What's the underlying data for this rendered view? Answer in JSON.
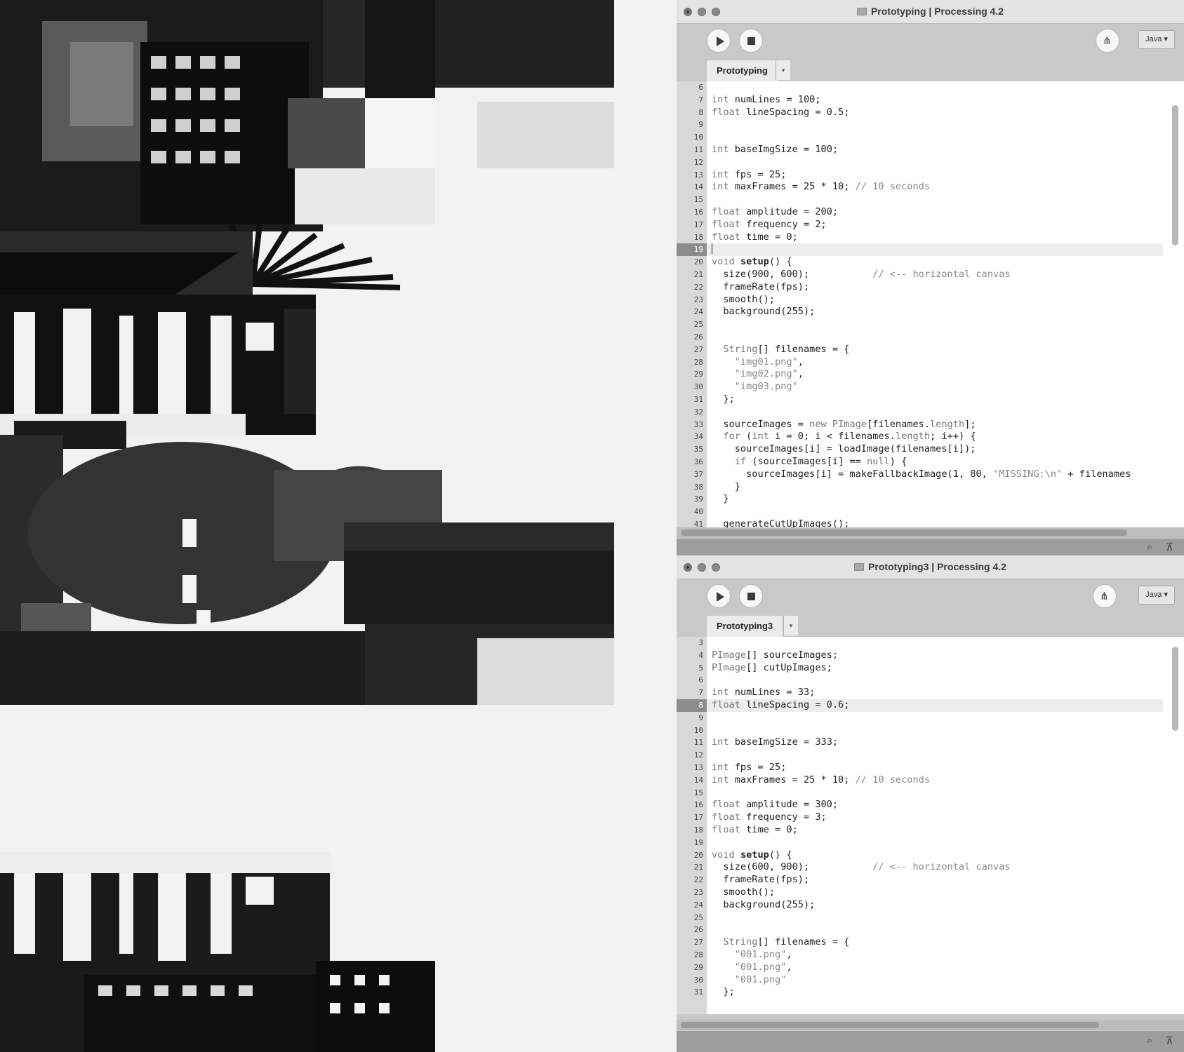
{
  "window1": {
    "title": "Prototyping | Processing 4.2",
    "tab": "Prototyping",
    "mode": "Java ▾",
    "tab_menu": "▾",
    "active_line": "19",
    "lines": [
      {
        "n": "6",
        "code": ""
      },
      {
        "n": "7",
        "code": "<span class='k'>int</span> numLines = 100;"
      },
      {
        "n": "8",
        "code": "<span class='k'>float</span> lineSpacing = 0.5;"
      },
      {
        "n": "9",
        "code": ""
      },
      {
        "n": "10",
        "code": ""
      },
      {
        "n": "11",
        "code": "<span class='k'>int</span> baseImgSize = 100;"
      },
      {
        "n": "12",
        "code": ""
      },
      {
        "n": "13",
        "code": "<span class='k'>int</span> fps = 25;"
      },
      {
        "n": "14",
        "code": "<span class='k'>int</span> maxFrames = 25 * 10; <span class='c'>// 10 seconds</span>"
      },
      {
        "n": "15",
        "code": ""
      },
      {
        "n": "16",
        "code": "<span class='k'>float</span> amplitude = 200;"
      },
      {
        "n": "17",
        "code": "<span class='k'>float</span> frequency = 2;"
      },
      {
        "n": "18",
        "code": "<span class='k'>float</span> time = 0;"
      },
      {
        "n": "19",
        "code": "<span class='caret'></span>"
      },
      {
        "n": "20",
        "code": "<span class='k'>void</span> <span class='b'>setup</span>() {"
      },
      {
        "n": "21",
        "code": "  size(900, 600);           <span class='c'>// &lt;-- horizontal canvas</span>"
      },
      {
        "n": "22",
        "code": "  frameRate(fps);"
      },
      {
        "n": "23",
        "code": "  smooth();"
      },
      {
        "n": "24",
        "code": "  background(255);"
      },
      {
        "n": "25",
        "code": ""
      },
      {
        "n": "26",
        "code": ""
      },
      {
        "n": "27",
        "code": "  <span class='k'>String</span>[] filenames = {"
      },
      {
        "n": "28",
        "code": "    <span class='s'>\"img01.png\"</span>,"
      },
      {
        "n": "29",
        "code": "    <span class='s'>\"img02.png\"</span>,"
      },
      {
        "n": "30",
        "code": "    <span class='s'>\"img03.png\"</span>"
      },
      {
        "n": "31",
        "code": "  };"
      },
      {
        "n": "32",
        "code": ""
      },
      {
        "n": "33",
        "code": "  sourceImages = <span class='k'>new</span> <span class='k'>PImage</span>[filenames.<span class='k'>length</span>];"
      },
      {
        "n": "34",
        "code": "  <span class='k'>for</span> (<span class='k'>int</span> i = 0; i &lt; filenames.<span class='k'>length</span>; i++) {"
      },
      {
        "n": "35",
        "code": "    sourceImages[i] = loadImage(filenames[i]);"
      },
      {
        "n": "36",
        "code": "    <span class='k'>if</span> (sourceImages[i] == <span class='k'>null</span>) {"
      },
      {
        "n": "37",
        "code": "      sourceImages[i] = makeFallbackImage(1, 80, <span class='s'>\"MISSING:\\n\"</span> + filenames"
      },
      {
        "n": "38",
        "code": "    }"
      },
      {
        "n": "39",
        "code": "  }"
      },
      {
        "n": "40",
        "code": ""
      },
      {
        "n": "41",
        "code": "  generateCutUpImages();"
      }
    ]
  },
  "window2": {
    "title": "Prototyping3 | Processing 4.2",
    "tab": "Prototyping3",
    "mode": "Java ▾",
    "tab_menu": "▾",
    "active_line": "8",
    "lines": [
      {
        "n": "3",
        "code": ""
      },
      {
        "n": "4",
        "code": "<span class='k'>PImage</span>[] sourceImages;"
      },
      {
        "n": "5",
        "code": "<span class='k'>PImage</span>[] cutUpImages;"
      },
      {
        "n": "6",
        "code": ""
      },
      {
        "n": "7",
        "code": "<span class='k'>int</span> numLines = 33;"
      },
      {
        "n": "8",
        "code": "<span class='k'>float</span> lineSpacing = 0.6;"
      },
      {
        "n": "9",
        "code": ""
      },
      {
        "n": "10",
        "code": ""
      },
      {
        "n": "11",
        "code": "<span class='k'>int</span> baseImgSize = 333;"
      },
      {
        "n": "12",
        "code": ""
      },
      {
        "n": "13",
        "code": "<span class='k'>int</span> fps = 25;"
      },
      {
        "n": "14",
        "code": "<span class='k'>int</span> maxFrames = 25 * 10; <span class='c'>// 10 seconds</span>"
      },
      {
        "n": "15",
        "code": ""
      },
      {
        "n": "16",
        "code": "<span class='k'>float</span> amplitude = 300;"
      },
      {
        "n": "17",
        "code": "<span class='k'>float</span> frequency = 3;"
      },
      {
        "n": "18",
        "code": "<span class='k'>float</span> time = 0;"
      },
      {
        "n": "19",
        "code": ""
      },
      {
        "n": "20",
        "code": "<span class='k'>void</span> <span class='b'>setup</span>() {"
      },
      {
        "n": "21",
        "code": "  size(600, 900);           <span class='c'>// &lt;-- horizontal canvas</span>"
      },
      {
        "n": "22",
        "code": "  frameRate(fps);"
      },
      {
        "n": "23",
        "code": "  smooth();"
      },
      {
        "n": "24",
        "code": "  background(255);"
      },
      {
        "n": "25",
        "code": ""
      },
      {
        "n": "26",
        "code": ""
      },
      {
        "n": "27",
        "code": "  <span class='k'>String</span>[] filenames = {"
      },
      {
        "n": "28",
        "code": "    <span class='s'>\"001.png\"</span>,"
      },
      {
        "n": "29",
        "code": "    <span class='s'>\"001.png\"</span>,"
      },
      {
        "n": "30",
        "code": "    <span class='s'>\"001.png\"</span>"
      },
      {
        "n": "31",
        "code": "  };"
      }
    ]
  },
  "icons": {
    "run": "play-icon",
    "stop": "stop-icon",
    "debug": "debugger-icon",
    "find": "search-icon",
    "console": "console-toggle-icon",
    "folder": "folder-icon"
  }
}
